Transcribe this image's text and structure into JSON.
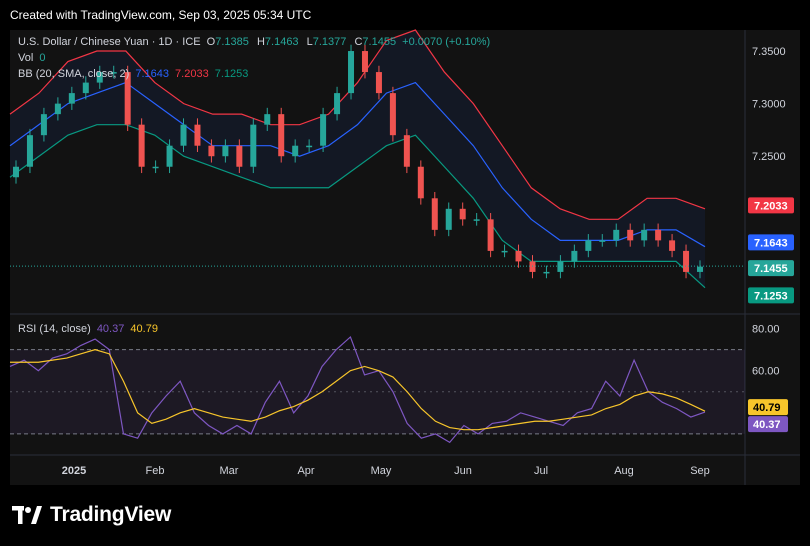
{
  "header": {
    "text": "Created with TradingView.com, Sep 03, 2025 05:34 UTC"
  },
  "legend": {
    "symbol": "U.S. Dollar / Chinese Yuan · 1D · ICE",
    "o_label": "O",
    "o": "7.1385",
    "h_label": "H",
    "h": "7.1463",
    "l_label": "L",
    "l": "7.1377",
    "c_label": "C",
    "c": "7.1455",
    "change": "+0.0070 (+0.10%)",
    "vol_label": "Vol",
    "vol_value": "0",
    "bb_label": "BB (20, SMA, close, 2)",
    "bb_basis": "7.1643",
    "bb_upper": "7.2033",
    "bb_lower": "7.1253",
    "rsi_label": "RSI (14, close)",
    "rsi_value": "40.37",
    "rsi_ma": "40.79"
  },
  "brand": {
    "logo_text": "TradingView"
  },
  "colors": {
    "up": "#26a69a",
    "down": "#ef5350",
    "upper": "#f23645",
    "basis": "#2962ff",
    "lower": "#089981",
    "rsi": "#7e57c2",
    "rsi_ma": "#f7c52b"
  },
  "chart_data": [
    {
      "type": "candlestick",
      "title": "U.S. Dollar / Chinese Yuan · 1D · ICE",
      "x_ticks": [
        "2025",
        "Feb",
        "Mar",
        "Apr",
        "May",
        "Jun",
        "Jul",
        "Aug",
        "Sep"
      ],
      "y_ticks": [
        "7.3500",
        "7.3000",
        "7.2500"
      ],
      "ylim": [
        7.1,
        7.37
      ],
      "price_labels": {
        "upper": "7.2033",
        "basis": "7.1643",
        "close": "7.1455",
        "lower": "7.1253"
      },
      "close_series": [
        7.24,
        7.27,
        7.29,
        7.3,
        7.31,
        7.32,
        7.33,
        7.33,
        7.28,
        7.24,
        7.24,
        7.26,
        7.28,
        7.26,
        7.25,
        7.26,
        7.24,
        7.28,
        7.29,
        7.25,
        7.26,
        7.26,
        7.29,
        7.31,
        7.35,
        7.33,
        7.31,
        7.27,
        7.24,
        7.21,
        7.18,
        7.2,
        7.19,
        7.19,
        7.16,
        7.16,
        7.15,
        7.14,
        7.14,
        7.15,
        7.16,
        7.17,
        7.17,
        7.18,
        7.17,
        7.18,
        7.17,
        7.16,
        7.14,
        7.145
      ],
      "bb_upper_series": [
        7.29,
        7.31,
        7.34,
        7.35,
        7.35,
        7.32,
        7.3,
        7.29,
        7.29,
        7.28,
        7.28,
        7.29,
        7.32,
        7.36,
        7.37,
        7.33,
        7.3,
        7.26,
        7.22,
        7.2,
        7.19,
        7.19,
        7.21,
        7.21,
        7.2
      ],
      "bb_basis_series": [
        7.26,
        7.28,
        7.3,
        7.31,
        7.32,
        7.3,
        7.28,
        7.26,
        7.26,
        7.26,
        7.25,
        7.26,
        7.28,
        7.31,
        7.32,
        7.29,
        7.26,
        7.22,
        7.19,
        7.17,
        7.17,
        7.17,
        7.18,
        7.18,
        7.164
      ],
      "bb_lower_series": [
        7.23,
        7.25,
        7.27,
        7.28,
        7.28,
        7.27,
        7.25,
        7.24,
        7.23,
        7.22,
        7.22,
        7.22,
        7.24,
        7.26,
        7.27,
        7.24,
        7.21,
        7.17,
        7.15,
        7.15,
        7.15,
        7.15,
        7.15,
        7.15,
        7.125
      ]
    },
    {
      "type": "line",
      "title": "RSI (14, close)",
      "y_ticks": [
        "80.00",
        "60.00"
      ],
      "ylim": [
        20,
        85
      ],
      "value_labels": {
        "rsi_ma": "40.79",
        "rsi": "40.37"
      },
      "series": [
        {
          "name": "RSI (14, close)",
          "values": [
            62,
            65,
            60,
            66,
            68,
            72,
            75,
            70,
            30,
            28,
            40,
            48,
            55,
            40,
            34,
            30,
            34,
            30,
            45,
            55,
            40,
            48,
            62,
            70,
            76,
            58,
            60,
            50,
            35,
            28,
            30,
            26,
            34,
            30,
            35,
            36,
            40,
            38,
            36,
            34,
            40,
            42,
            55,
            48,
            65,
            50,
            45,
            42,
            38,
            40.37
          ]
        },
        {
          "name": "RSI-based MA",
          "values": [
            64,
            64,
            64,
            65,
            66,
            68,
            70,
            68,
            55,
            40,
            35,
            37,
            40,
            42,
            40,
            38,
            37,
            36,
            38,
            41,
            43,
            46,
            50,
            55,
            60,
            62,
            60,
            57,
            50,
            42,
            36,
            33,
            32,
            32,
            33,
            34,
            35,
            36,
            36,
            37,
            38,
            39,
            42,
            44,
            48,
            50,
            49,
            47,
            44,
            40.79
          ]
        }
      ]
    }
  ]
}
